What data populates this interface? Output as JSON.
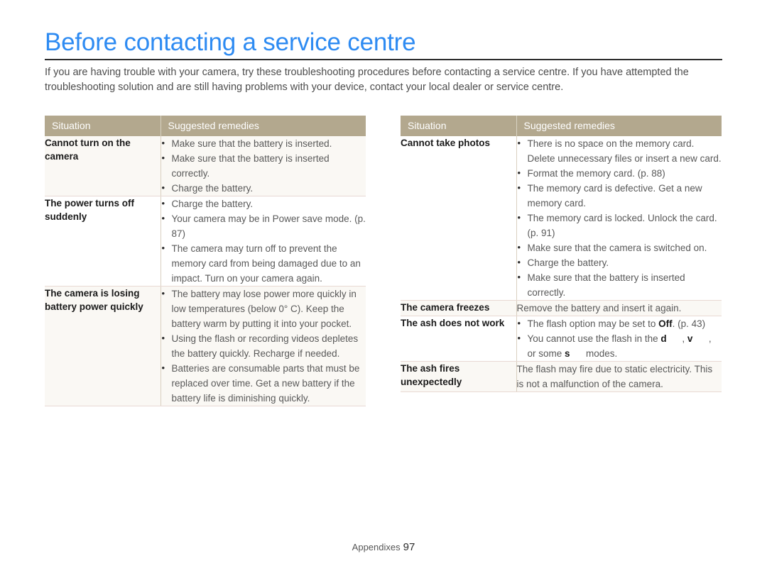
{
  "document": {
    "title": "Before contacting a service centre",
    "title_color": "#2e8bf2",
    "intro": "If you are having trouble with your camera, try these troubleshooting procedures before contacting a service centre. If you have attempted the troubleshooting solution and are still having problems with your device, contact your local dealer or service centre.",
    "footer_label": "Appendixes",
    "footer_page": "97",
    "header_bg": "#b3a88e",
    "row_shade": "#faf8f4"
  },
  "tables": {
    "left": {
      "headers": {
        "situation": "Situation",
        "remedies": "Suggested remedies"
      },
      "rows": [
        {
          "situation": "Cannot turn on the camera",
          "bullets": [
            "Make sure that the battery is inserted.",
            "Make sure that the battery is inserted correctly.",
            "Charge the battery."
          ]
        },
        {
          "situation": "The power turns off suddenly",
          "bullets": [
            "Charge the battery.",
            "Your camera may be in Power save mode. (p. 87)",
            "The camera may turn off to prevent the memory card from being damaged due to an impact. Turn on your camera again."
          ]
        },
        {
          "situation": "The camera is losing battery power quickly",
          "bullets": [
            "The battery may lose power more quickly in low temperatures (below 0° C). Keep the battery warm by putting it into your pocket.",
            "Using the flash or recording videos depletes the battery quickly. Recharge if needed.",
            "Batteries are consumable parts that must be replaced over time. Get a new battery if the battery life is diminishing quickly."
          ]
        }
      ]
    },
    "right": {
      "headers": {
        "situation": "Situation",
        "remedies": "Suggested remedies"
      },
      "rows": [
        {
          "situation": "Cannot take photos",
          "bullets": [
            "There is no space on the memory card. Delete unnecessary files or insert a new card.",
            "Format the memory card. (p. 88)",
            "The memory card is defective. Get a new memory card.",
            "The memory card is locked. Unlock the card. (p. 91)",
            "Make sure that the camera is switched on.",
            "Charge the battery.",
            "Make sure that the battery is inserted correctly."
          ]
        },
        {
          "situation": "The camera freezes",
          "text": "Remove the battery and insert it again."
        },
        {
          "situation": "The ash does not work",
          "bullet_parts": [
            {
              "before": "The flash option may be set to ",
              "bold": "Off",
              "after": ". (p. 43)"
            },
            {
              "before": "You cannot use the flash in the ",
              "glyph1": "d",
              "mid1": ", ",
              "glyph2": "v",
              "mid2": ", or some ",
              "glyph3": "s",
              "after": "modes."
            }
          ]
        },
        {
          "situation": "The ash fires unexpectedly",
          "text": "The flash may fire due to static electricity. This is not a malfunction of the camera."
        }
      ]
    }
  }
}
